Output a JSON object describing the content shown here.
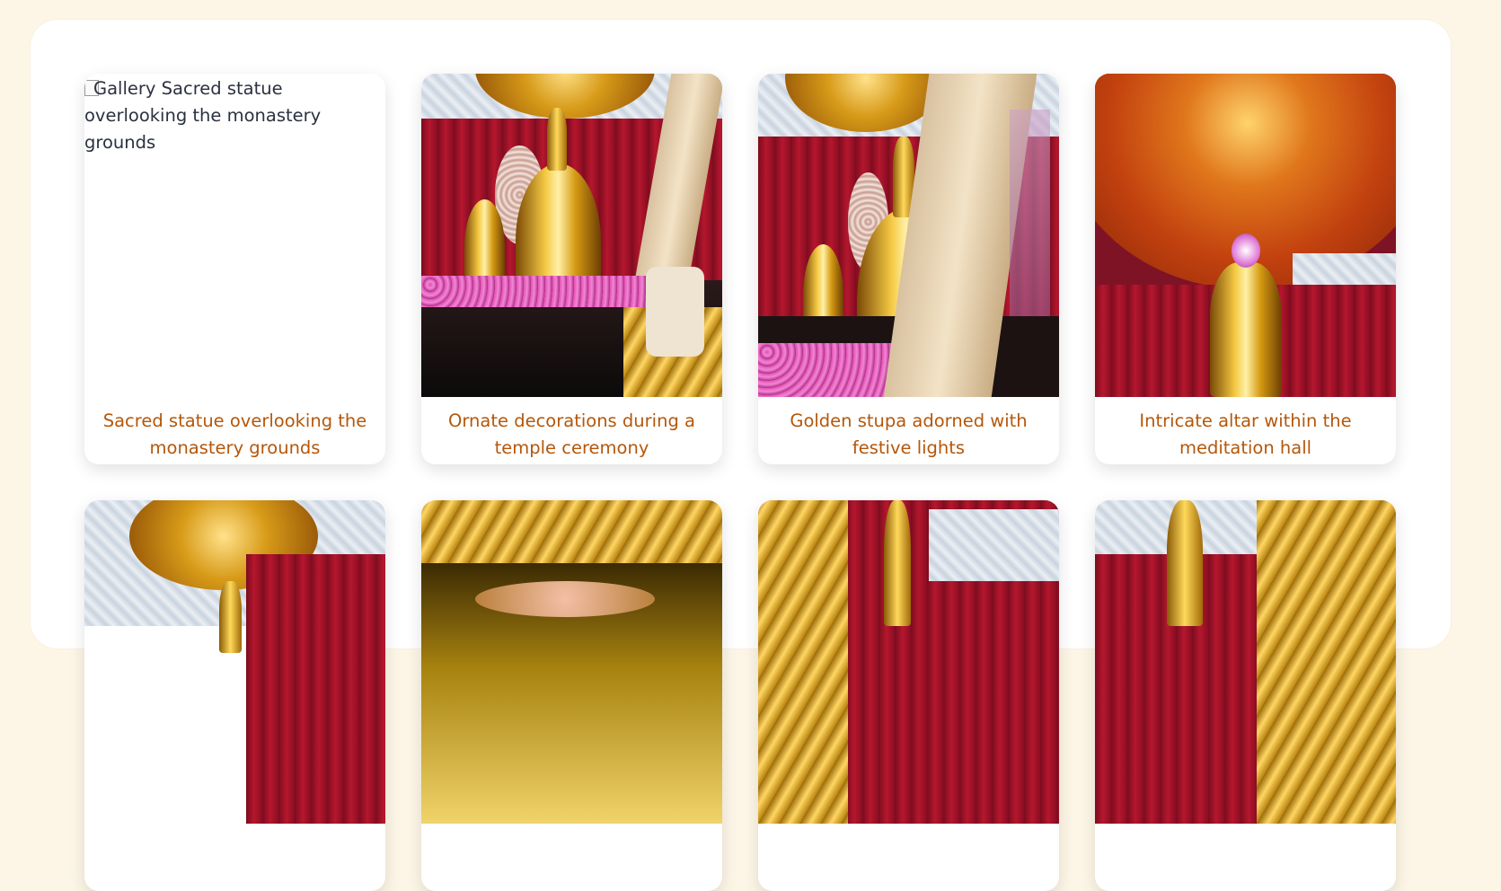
{
  "gallery": {
    "items": [
      {
        "caption": "Sacred statue overlooking the monastery grounds",
        "alt": "Gallery Sacred statue overlooking the monastery grounds",
        "image_loaded": false
      },
      {
        "caption": "Ornate decorations during a temple ceremony",
        "image_loaded": true
      },
      {
        "caption": "Golden stupa adorned with festive lights",
        "image_loaded": true
      },
      {
        "caption": "Intricate altar within the meditation hall",
        "image_loaded": true
      },
      {
        "caption": "",
        "image_loaded": true
      },
      {
        "caption": "",
        "image_loaded": true
      },
      {
        "caption": "",
        "image_loaded": true
      },
      {
        "caption": "",
        "image_loaded": true
      }
    ]
  },
  "colors": {
    "page_background": "#fdf6e7",
    "panel_background": "#ffffff",
    "caption_text": "#b5570a",
    "alt_text": "#2a3140"
  }
}
